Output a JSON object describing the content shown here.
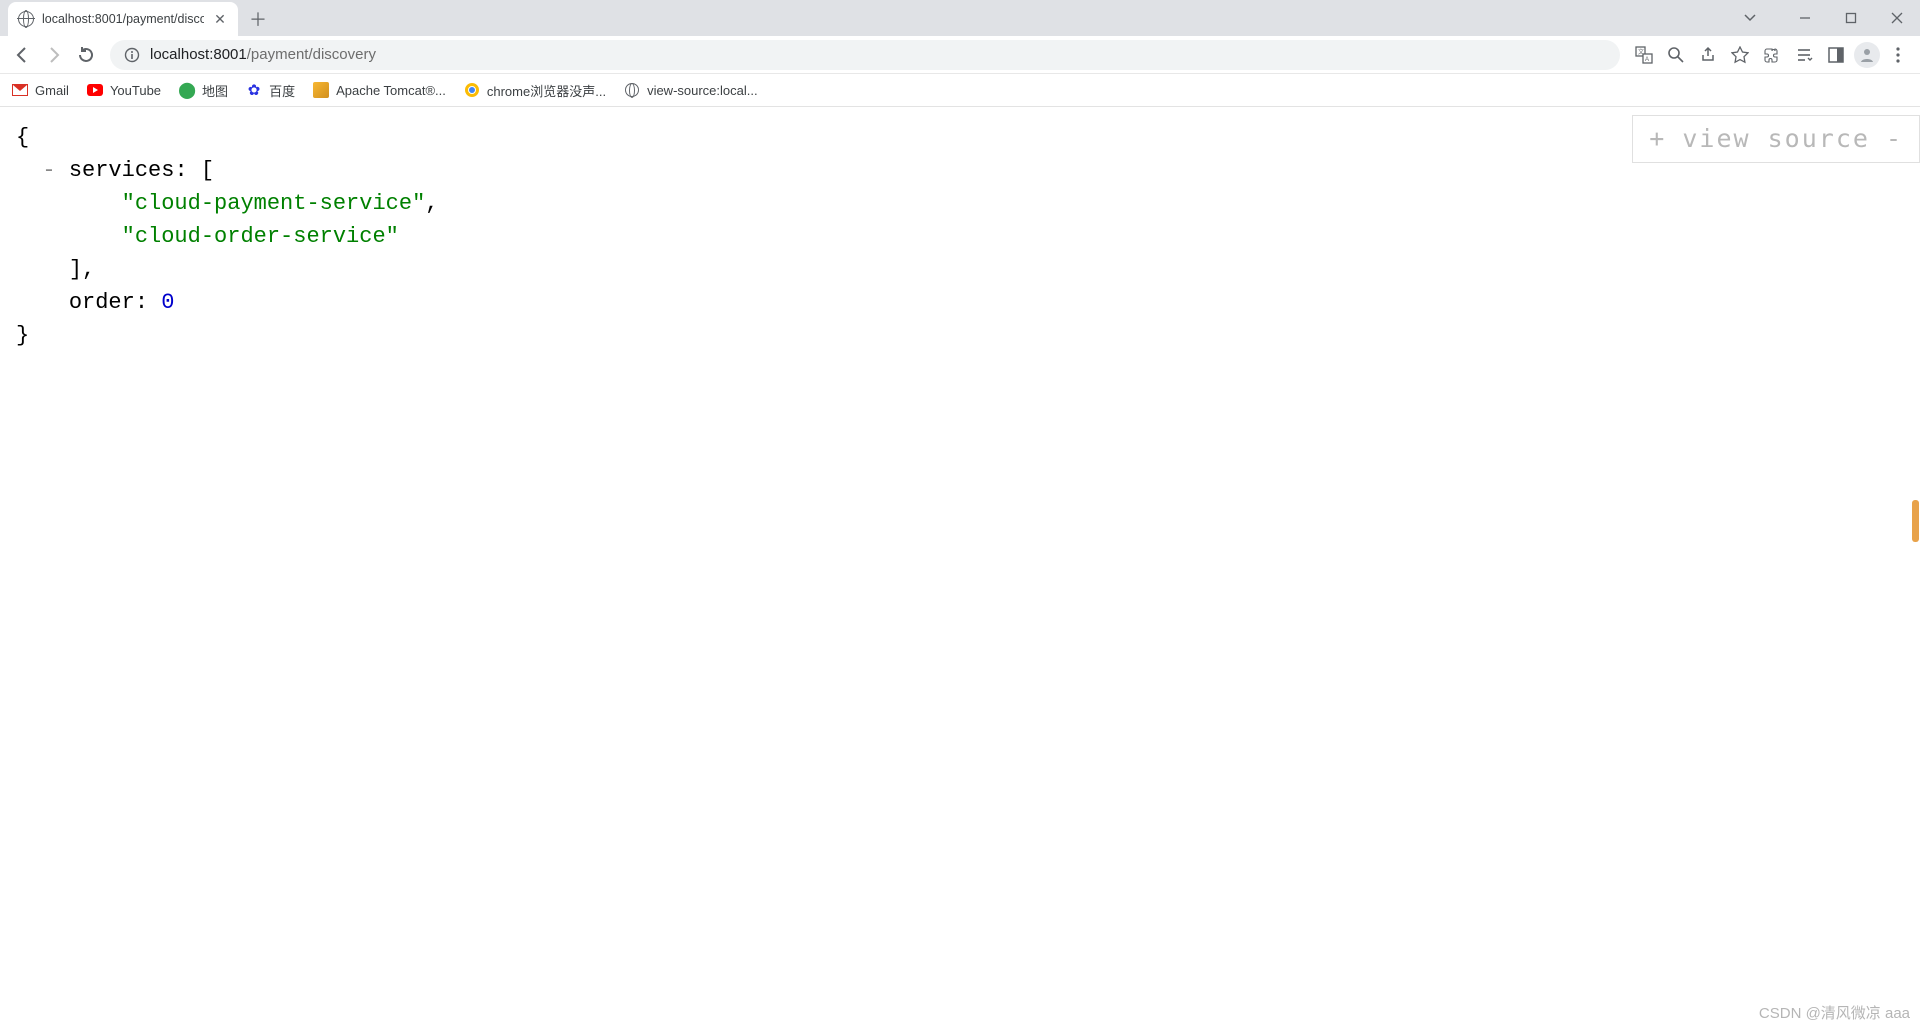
{
  "tab": {
    "title": "localhost:8001/payment/disco"
  },
  "url": {
    "host": "localhost:8001",
    "path": "/payment/discovery"
  },
  "bookmarks": [
    {
      "label": "Gmail"
    },
    {
      "label": "YouTube"
    },
    {
      "label": "地图"
    },
    {
      "label": "百度"
    },
    {
      "label": "Apache Tomcat®..."
    },
    {
      "label": "chrome浏览器没声..."
    },
    {
      "label": "view-source:local..."
    }
  ],
  "viewsource": {
    "plus": "+",
    "label": "view source",
    "minus": "-"
  },
  "json": {
    "open": "{",
    "toggle": "-",
    "services_key": "services",
    "services_open": ": [",
    "service0": "\"cloud-payment-service\"",
    "comma": ",",
    "service1": "\"cloud-order-service\"",
    "services_close": "],",
    "order_key": "order",
    "order_sep": ": ",
    "order_val": "0",
    "close": "}"
  },
  "watermark": "CSDN @清风微凉 aaa"
}
